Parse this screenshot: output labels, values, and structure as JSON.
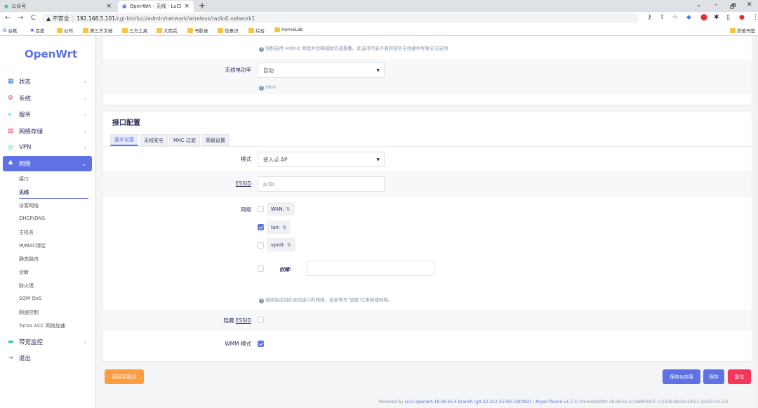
{
  "browser": {
    "tabs": [
      {
        "title": "公众号",
        "close": "×"
      },
      {
        "title": "OpenWrt - 无线 - LuCI",
        "close": "×"
      }
    ],
    "new_tab": "+",
    "window_controls": [
      "⌄",
      "–",
      "🗗",
      "✕"
    ],
    "nav": {
      "back": "←",
      "forward": "→",
      "reload": "C"
    },
    "url_warning": "▲ 不安全",
    "url_host": "192.168.5.101",
    "url_path": "/cgi-bin/luci/admin/network/wireless/radio0.network1",
    "bookmarks": [
      "谷歌",
      "百度",
      "公司",
      "第三方文档",
      "三方工具",
      "大而完",
      "书影音",
      "信意识",
      "综合",
      "HomeLab"
    ],
    "other_bookmarks": "其他书签"
  },
  "sidebar": {
    "logo": "OpenWrt",
    "items": [
      {
        "label": "状态",
        "icon": "▦",
        "chevron": "›"
      },
      {
        "label": "系统",
        "icon": "⚙",
        "chevron": "›"
      },
      {
        "label": "服务",
        "icon": "⚹",
        "chevron": "›"
      },
      {
        "label": "网络存储",
        "icon": "▤",
        "chevron": "›"
      },
      {
        "label": "VPN",
        "icon": "◎",
        "chevron": "›"
      },
      {
        "label": "网络",
        "icon": "♣",
        "chevron": "⌄"
      }
    ],
    "subitems": [
      "接口",
      "无线",
      "访客网络",
      "DHCP/DNS",
      "主机名",
      "IP/MAC绑定",
      "静态路由",
      "诊断",
      "防火墙",
      "SQM QoS",
      "网速控制",
      "Turbo ACC 网络加速"
    ],
    "bottom_items": [
      {
        "label": "带宽监控",
        "icon": "▬",
        "chevron": "›"
      },
      {
        "label": "退出",
        "icon": "⇥"
      }
    ]
  },
  "top_card": {
    "hint_top": "强制启用 40MHz 频宽并忽略辅助信道重叠。此选项可能不兼容某些无线硬件导致无法启用",
    "power_label": "无线电功率",
    "power_value": "自动",
    "power_hint": "dBm"
  },
  "iface": {
    "title": "接口配置",
    "tabs": [
      "基本设置",
      "无线安全",
      "MAC 过滤",
      "高级设置"
    ],
    "mode_label": "模式",
    "mode_value": "接入点 AP",
    "essid_label": "ESSID",
    "essid_value": "pi3b",
    "network_label": "网络",
    "networks": [
      {
        "name": "WAN:",
        "checked": false
      },
      {
        "name": "lan:",
        "checked": true
      },
      {
        "name": "vpn0:",
        "checked": false
      }
    ],
    "create_label": "创建:",
    "network_hint": "选择指派到此无线接口的网络，或者填写\"创建\"栏来新建网络。",
    "hide_essid_label_pre": "隐藏 ",
    "hide_essid_label": "ESSID",
    "wmm_label": "WMM 模式"
  },
  "buttons": {
    "back": "返回至概况",
    "save_apply": "保存&应用",
    "save": "保存",
    "reset": "复位"
  },
  "footer": {
    "text1": "Powered by ",
    "link1": "LuCI openwrt-18.06-k5.4 branch (git-22.312.35760-7afcfb2)",
    "sep": " / ",
    "link2": "ArgonTheme v1.7.3",
    "text2": " / ImmortalWrt 18.06-k5.4-SNAPSHOT r12339-8b50c1df21 (2023-04-23)"
  },
  "colors": {
    "accent": "#5e72e4",
    "reset": "#f5365c",
    "back": "#fb9d40"
  }
}
